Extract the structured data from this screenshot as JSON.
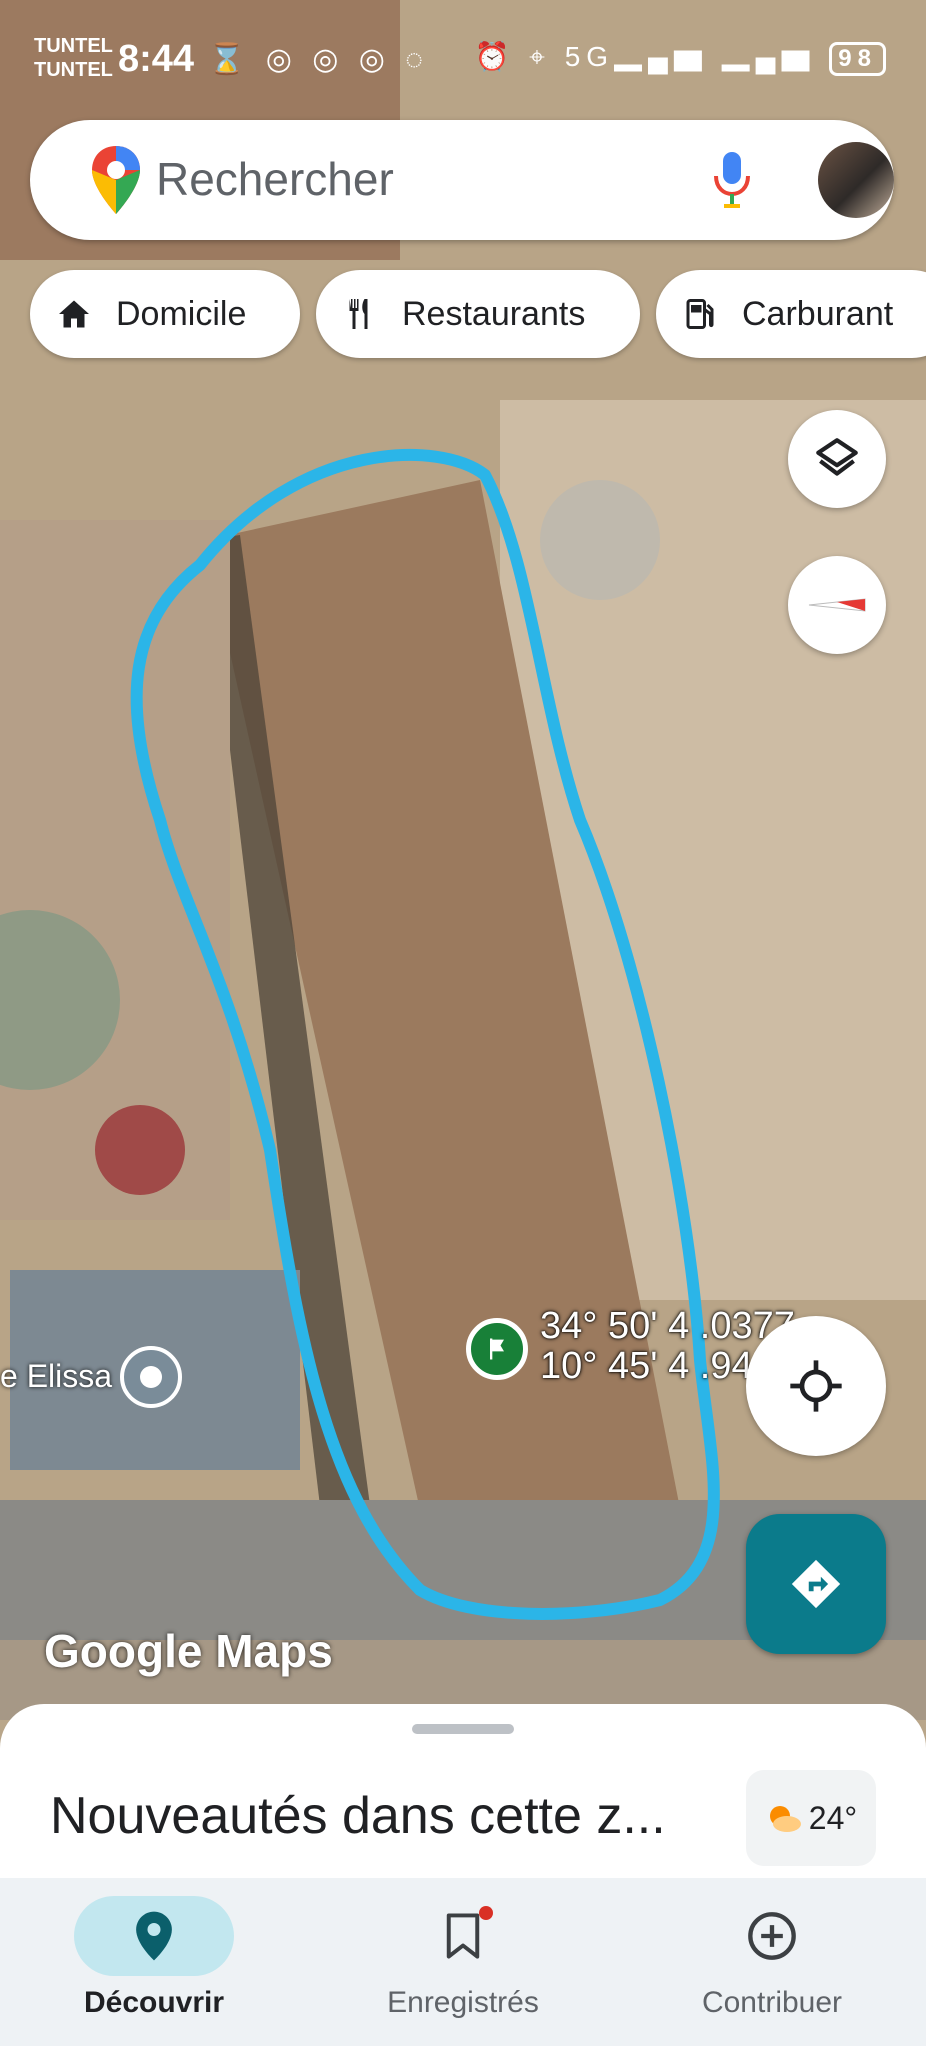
{
  "status_bar": {
    "carrier_1": "TUNTEL",
    "carrier_2": "TUNTEL",
    "time": "8:44",
    "network_label": "5G",
    "battery": "98"
  },
  "search": {
    "placeholder": "Rechercher",
    "icons": [
      "maps-pin-icon",
      "microphone-icon",
      "profile-avatar"
    ]
  },
  "chips": [
    {
      "label": "Domicile",
      "icon": "home-icon"
    },
    {
      "label": "Restaurants",
      "icon": "fork-knife-icon"
    },
    {
      "label": "Carburant",
      "icon": "gas-station-icon"
    }
  ],
  "map": {
    "coordinates_line1": "34° 50' 4 .0377",
    "coordinates_line2": "10° 45' 4 .94",
    "place_label": "e Elissa",
    "watermark": "Google Maps"
  },
  "sheet": {
    "title": "Nouveautés dans cette z...",
    "temperature": "24°"
  },
  "nav": [
    {
      "label": "Découvrir",
      "icon": "explore-pin-icon",
      "active": true
    },
    {
      "label": "Enregistrés",
      "icon": "bookmark-icon",
      "active": false
    },
    {
      "label": "Contribuer",
      "icon": "add-circle-icon",
      "active": false
    }
  ],
  "colors": {
    "accent_teal": "#0b7b8b",
    "outline_blue": "#2bb5e8",
    "flag_green": "#188038"
  }
}
